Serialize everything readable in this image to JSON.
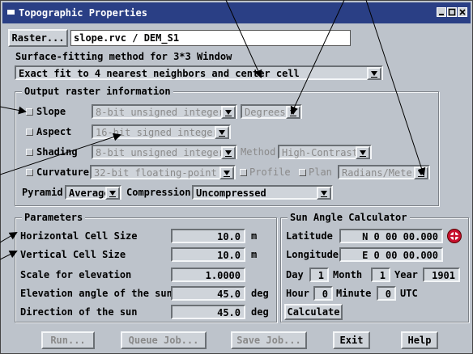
{
  "window": {
    "title": "Topographic Properties"
  },
  "raster": {
    "button_label": "Raster...",
    "path": "slope.rvc / DEM_S1"
  },
  "surface": {
    "label": "Surface-fitting method for 3*3 Window",
    "method": "Exact fit to 4 nearest neighbors and center cell"
  },
  "output": {
    "title": "Output raster information",
    "slope": {
      "label": "Slope",
      "type": "8-bit unsigned integer",
      "units": "Degrees"
    },
    "aspect": {
      "label": "Aspect",
      "type": "16-bit signed integer"
    },
    "shading": {
      "label": "Shading",
      "type": "8-bit unsigned integer",
      "method_label": "Method",
      "method": "High-Contrast"
    },
    "curvature": {
      "label": "Curvature",
      "type": "32-bit floating-point",
      "profile_label": "Profile",
      "plan_label": "Plan",
      "units": "Radians/Meter"
    },
    "pyramid_label": "Pyramid",
    "pyramid": "Average",
    "compression_label": "Compression",
    "compression": "Uncompressed"
  },
  "parameters": {
    "title": "Parameters",
    "rows": [
      {
        "label": "Horizontal Cell Size",
        "value": "10.0",
        "unit": "m"
      },
      {
        "label": "Vertical Cell Size",
        "value": "10.0",
        "unit": "m"
      },
      {
        "label": "Scale for elevation",
        "value": "1.0000",
        "unit": ""
      },
      {
        "label": "Elevation angle of the sun",
        "value": "45.0",
        "unit": "deg"
      },
      {
        "label": "Direction of the sun",
        "value": "45.0",
        "unit": "deg"
      }
    ]
  },
  "sun": {
    "title": "Sun Angle Calculator",
    "latitude_label": "Latitude",
    "latitude": "N 0 00 00.000",
    "longitude_label": "Longitude",
    "longitude": "E 0 00 00.000",
    "day_label": "Day",
    "day": "1",
    "month_label": "Month",
    "month": "1",
    "year_label": "Year",
    "year": "1901",
    "hour_label": "Hour",
    "hour": "0",
    "minute_label": "Minute",
    "minute": "0",
    "utc_label": "UTC",
    "calculate_label": "Calculate"
  },
  "buttons": {
    "run": "Run...",
    "queue": "Queue Job...",
    "save": "Save Job...",
    "exit": "Exit",
    "help": "Help"
  },
  "colors": {
    "titlebar": "#2a3f85",
    "dialog": "#bdc3cb",
    "callout_arrow": "#000000",
    "location_icon": "#c8102e"
  }
}
